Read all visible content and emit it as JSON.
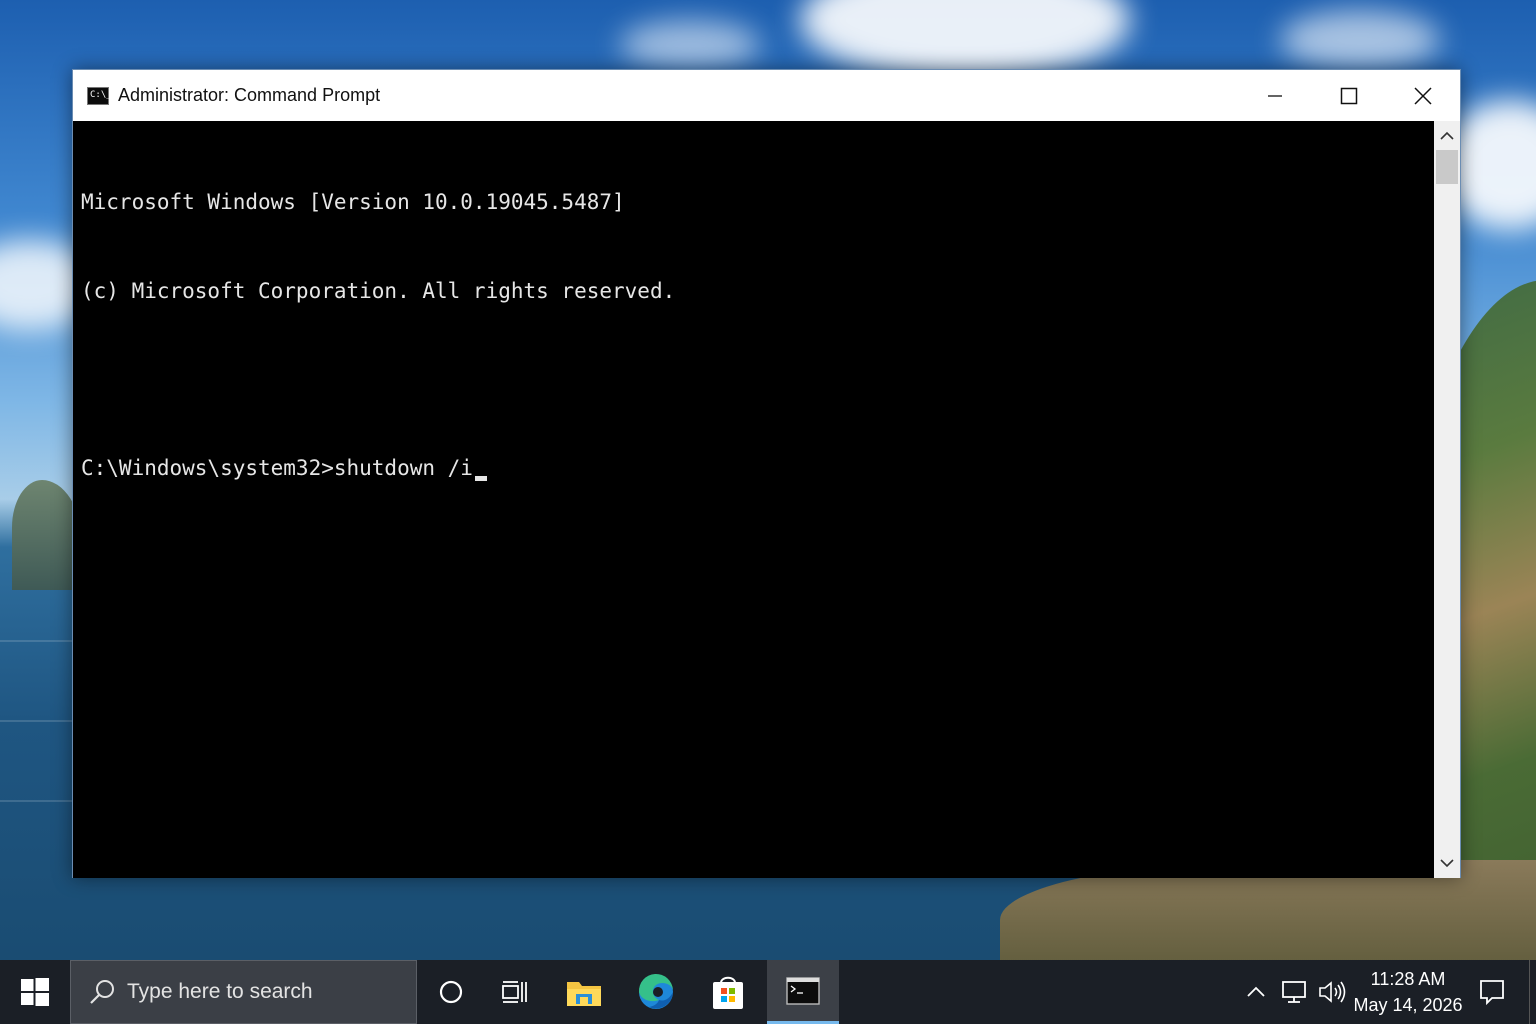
{
  "window": {
    "title": "Administrator: Command Prompt",
    "icon_label": "C:\\_"
  },
  "console": {
    "lines": [
      "Microsoft Windows [Version 10.0.19045.5487]",
      "(c) Microsoft Corporation. All rights reserved.",
      "",
      "C:\\Windows\\system32>shutdown /i"
    ]
  },
  "taskbar": {
    "search_placeholder": "Type here to search",
    "apps": [
      "cortana-circle-icon",
      "task-view-icon",
      "file-explorer-icon",
      "edge-icon",
      "store-icon",
      "command-prompt-icon"
    ],
    "active_app": "command-prompt-icon"
  },
  "clock": {
    "time": "11:28 AM",
    "date": "May 14, 2026"
  },
  "colors": {
    "accent": "#76b9ed",
    "console_bg": "#000000",
    "console_fg": "#e6e6e6",
    "taskbar_bg": "#1b1f26"
  }
}
